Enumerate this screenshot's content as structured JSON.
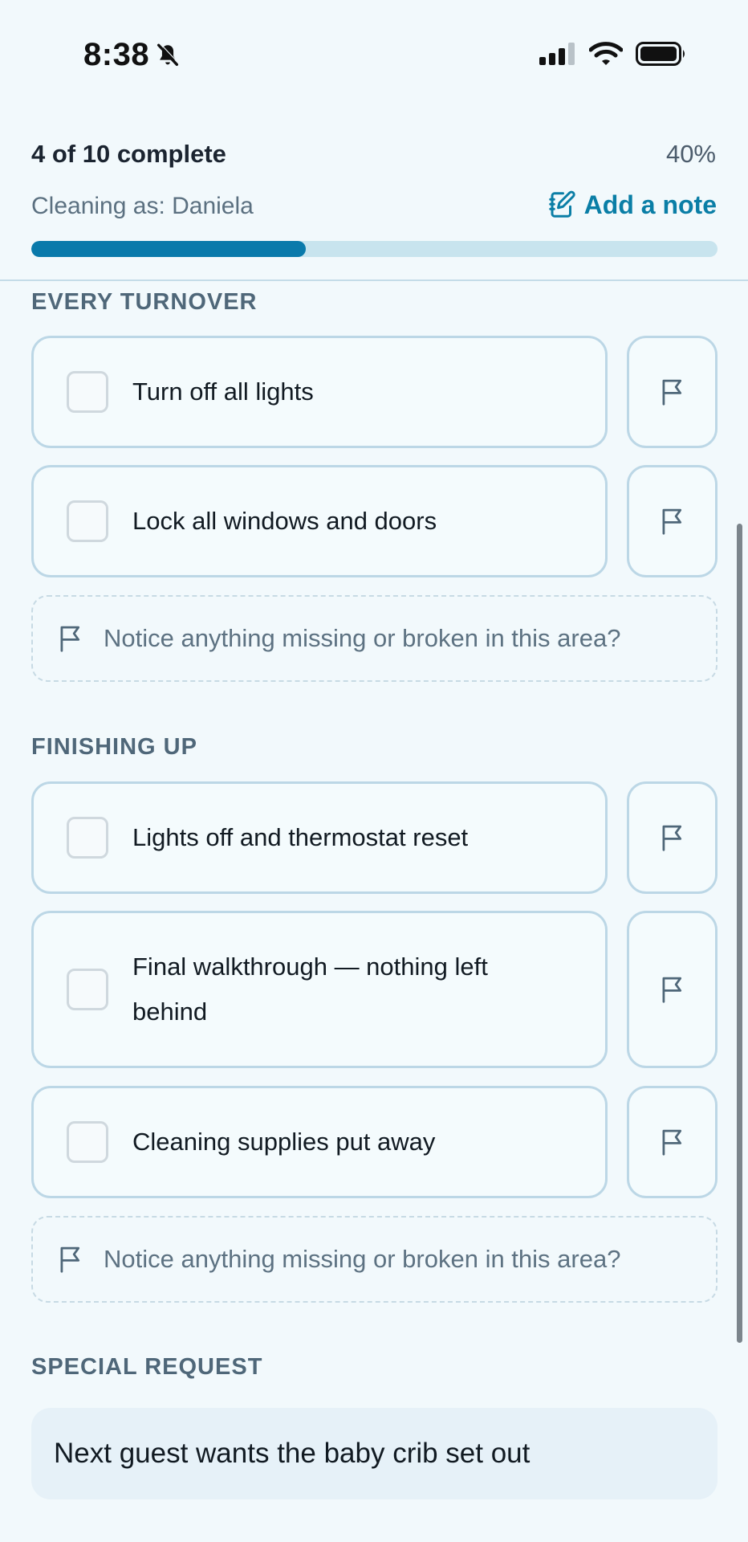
{
  "status_bar": {
    "time": "8:38"
  },
  "header": {
    "progress_label": "4 of 10 complete",
    "progress_percent": "40%",
    "progress_value": 40,
    "cleaning_as": "Cleaning as: Daniela",
    "add_note_label": "Add a note"
  },
  "sections": [
    {
      "title": "EVERY TURNOVER",
      "tasks": [
        {
          "label": "Turn off all lights"
        },
        {
          "label": "Lock all windows and doors"
        }
      ],
      "notice": "Notice anything missing or broken in this area?"
    },
    {
      "title": "FINISHING UP",
      "tasks": [
        {
          "label": "Lights off and thermostat reset"
        },
        {
          "label": "Final walkthrough — nothing left behind"
        },
        {
          "label": "Cleaning supplies put away"
        }
      ],
      "notice": "Notice anything missing or broken in this area?"
    }
  ],
  "special_request": {
    "title": "SPECIAL REQUEST",
    "text": "Next guest wants the baby crib set out"
  },
  "colors": {
    "accent": "#0a7aab",
    "track": "#c8e4ee",
    "background": "#f2f9fc",
    "card_border": "#bcd7e6"
  },
  "icons": [
    "bell-slash-icon",
    "cellular-signal-icon",
    "wifi-icon",
    "battery-icon",
    "note-edit-icon",
    "flag-icon"
  ]
}
